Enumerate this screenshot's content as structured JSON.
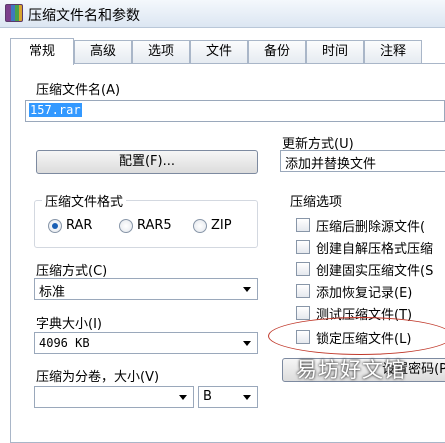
{
  "window": {
    "title": "压缩文件名和参数"
  },
  "tabs": [
    {
      "label": "常规",
      "active": true
    },
    {
      "label": "高级"
    },
    {
      "label": "选项"
    },
    {
      "label": "文件"
    },
    {
      "label": "备份"
    },
    {
      "label": "时间"
    },
    {
      "label": "注释"
    }
  ],
  "archive_name": {
    "label": "压缩文件名(A)",
    "value": "157.rar"
  },
  "update_mode": {
    "label": "更新方式(U)",
    "value": "添加并替换文件"
  },
  "profiles_button": {
    "label": "配置(F)..."
  },
  "format_group": {
    "title": "压缩文件格式",
    "options": [
      {
        "label": "RAR",
        "selected": true
      },
      {
        "label": "RAR5",
        "selected": false
      },
      {
        "label": "ZIP",
        "selected": false
      }
    ]
  },
  "compression_method": {
    "label": "压缩方式(C)",
    "value": "标准"
  },
  "dictionary_size": {
    "label": "字典大小(I)",
    "value": "4096 KB"
  },
  "split_volumes": {
    "label": "压缩为分卷，大小(V)",
    "value": "",
    "unit": "B"
  },
  "options_group": {
    "title": "压缩选项",
    "items": [
      {
        "label": "压缩后删除源文件(",
        "checked": false
      },
      {
        "label": "创建自解压格式压缩",
        "checked": false
      },
      {
        "label": "创建固实压缩文件(S",
        "checked": false
      },
      {
        "label": "添加恢复记录(E)",
        "checked": false
      },
      {
        "label": "测试压缩文件(T)",
        "checked": false
      },
      {
        "label": "锁定压缩文件(L)",
        "checked": false
      }
    ]
  },
  "password_button": {
    "label": "设置密码(P"
  },
  "watermark": {
    "text": "易坊好文馆"
  },
  "colors": {
    "annotation": "#c0392b",
    "selection": "#3399ff"
  }
}
